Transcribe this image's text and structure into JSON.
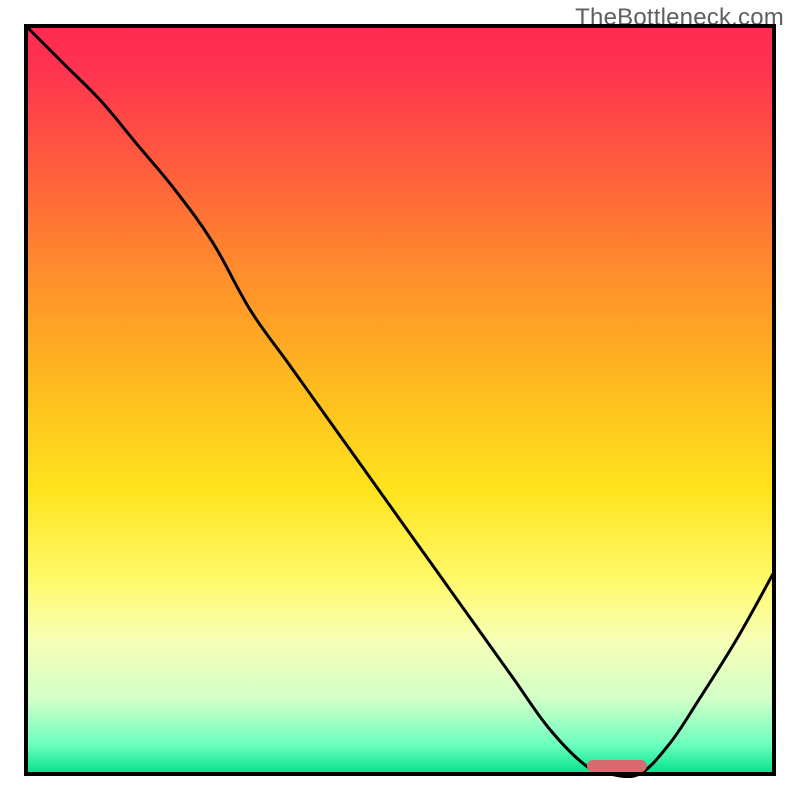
{
  "watermark": "TheBottleneck.com",
  "chart_data": {
    "type": "line",
    "title": "",
    "xlabel": "",
    "ylabel": "",
    "xlim": [
      0,
      100
    ],
    "ylim": [
      0,
      100
    ],
    "grid": false,
    "legend": false,
    "series": [
      {
        "name": "bottleneck-curve",
        "x": [
          0,
          5,
          10,
          15,
          20,
          25,
          30,
          35,
          40,
          45,
          50,
          55,
          60,
          65,
          70,
          75,
          78,
          82,
          86,
          90,
          95,
          100
        ],
        "y": [
          100,
          95,
          90,
          84,
          78,
          71,
          62,
          55,
          48,
          41,
          34,
          27,
          20,
          13,
          6,
          1,
          0,
          0,
          4,
          10,
          18,
          27
        ]
      }
    ],
    "optimal_band": {
      "x_start": 75,
      "x_end": 83,
      "color": "#d96a6f"
    },
    "gradient_stops": [
      {
        "offset": 0.0,
        "color": "#ff2b52"
      },
      {
        "offset": 0.06,
        "color": "#ff3350"
      },
      {
        "offset": 0.18,
        "color": "#ff5a3e"
      },
      {
        "offset": 0.32,
        "color": "#ff8a2d"
      },
      {
        "offset": 0.48,
        "color": "#ffbb1f"
      },
      {
        "offset": 0.62,
        "color": "#ffe31d"
      },
      {
        "offset": 0.74,
        "color": "#fff96a"
      },
      {
        "offset": 0.82,
        "color": "#f8ffb6"
      },
      {
        "offset": 0.9,
        "color": "#d2ffc8"
      },
      {
        "offset": 0.96,
        "color": "#6dffbf"
      },
      {
        "offset": 1.0,
        "color": "#00e28a"
      }
    ],
    "border_color": "#000000",
    "curve_color": "#000000"
  }
}
